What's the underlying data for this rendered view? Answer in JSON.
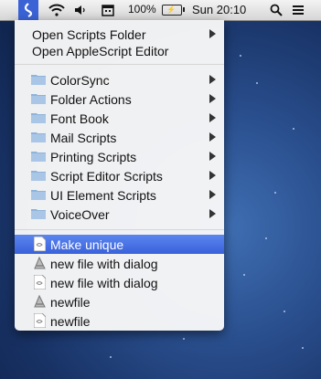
{
  "menubar": {
    "battery_percent": "100%",
    "clock": "Sun 20:10",
    "icons": [
      "script-menu-icon",
      "wifi-icon",
      "volume-icon",
      "calendar-icon",
      "battery-icon",
      "search-icon",
      "list-icon"
    ]
  },
  "menu": {
    "top_items": [
      {
        "label": "Open Scripts Folder",
        "submenu": true
      },
      {
        "label": "Open AppleScript Editor",
        "submenu": false
      }
    ],
    "folders": [
      {
        "label": "ColorSync"
      },
      {
        "label": "Folder Actions"
      },
      {
        "label": "Font Book"
      },
      {
        "label": "Mail Scripts"
      },
      {
        "label": "Printing Scripts"
      },
      {
        "label": "Script Editor Scripts"
      },
      {
        "label": "UI Element Scripts"
      },
      {
        "label": "VoiceOver"
      }
    ],
    "scripts": [
      {
        "label": "Make unique",
        "icon": "script-doc-icon",
        "selected": true
      },
      {
        "label": "new file with dialog",
        "icon": "applescript-icon",
        "selected": false
      },
      {
        "label": "new file with dialog",
        "icon": "script-doc-icon",
        "selected": false
      },
      {
        "label": "newfile",
        "icon": "applescript-icon",
        "selected": false
      },
      {
        "label": "newfile",
        "icon": "script-doc-icon",
        "selected": false
      }
    ]
  },
  "colors": {
    "selection": "#3a61da",
    "menubar_highlight": "#3b63d6",
    "desktop": "#1f3f7a"
  }
}
